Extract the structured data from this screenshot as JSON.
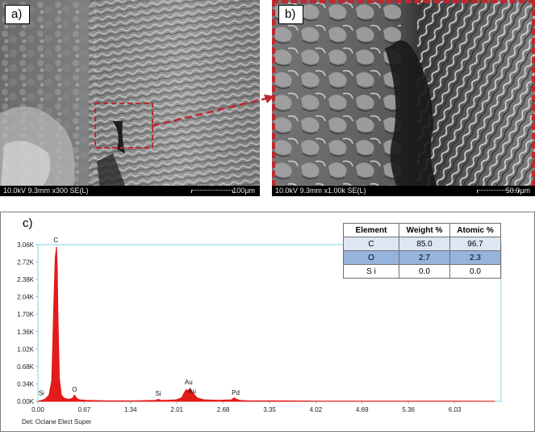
{
  "panel_a": {
    "label": "a)",
    "info": "10.0kV 9.3mm x300 SE(L)",
    "scale": "100µm"
  },
  "panel_b": {
    "label": "b)",
    "info": "10.0kV 9.3mm x1.00k SE(L)",
    "scale": "50.0µm"
  },
  "panel_c": {
    "label": "c)",
    "detector": "Det: Octane Elect Super",
    "table": {
      "headers": [
        "Element",
        "Weight %",
        "Atomic %"
      ],
      "rows": [
        {
          "element": "C",
          "weight": "85.0",
          "atomic": "96.7"
        },
        {
          "element": "O",
          "weight": "2.7",
          "atomic": "2.3"
        },
        {
          "element": "S i",
          "weight": "0.0",
          "atomic": "0.0"
        }
      ]
    }
  },
  "colors": {
    "highlight": "#c0272d",
    "spectrum": "#e31b1b",
    "axis": "#7fd0e6"
  },
  "chart_data": {
    "type": "area",
    "title": "",
    "xlabel": "",
    "ylabel": "",
    "xlim": [
      0.0,
      6.7
    ],
    "ylim": [
      0,
      3.06
    ],
    "x_ticks": [
      "0.00",
      "0.67",
      "1.34",
      "2.01",
      "2.68",
      "3.35",
      "4.02",
      "4.69",
      "5.36",
      "6.03"
    ],
    "y_ticks": [
      "0.00K",
      "0.34K",
      "0.68K",
      "1.02K",
      "1.36K",
      "1.70K",
      "2.04K",
      "2.38K",
      "2.72K",
      "3.06K"
    ],
    "series": [
      {
        "x": [
          0.0,
          0.1,
          0.16,
          0.2,
          0.23,
          0.25,
          0.27,
          0.28,
          0.29,
          0.31,
          0.34,
          0.38,
          0.45,
          0.5,
          0.53,
          0.56,
          0.6,
          0.7,
          1.0,
          1.4,
          1.7,
          1.74,
          1.78,
          1.85,
          2.0,
          2.08,
          2.12,
          2.15,
          2.17,
          2.2,
          2.24,
          2.3,
          2.4,
          2.6,
          2.8,
          2.84,
          2.87,
          2.92,
          3.05,
          3.4,
          4.0,
          5.0,
          6.0,
          6.6
        ],
        "values": [
          0.0,
          0.04,
          0.12,
          0.4,
          1.9,
          2.8,
          3.02,
          2.6,
          1.7,
          0.45,
          0.12,
          0.06,
          0.04,
          0.06,
          0.12,
          0.06,
          0.03,
          0.02,
          0.01,
          0.01,
          0.02,
          0.04,
          0.02,
          0.02,
          0.03,
          0.07,
          0.18,
          0.23,
          0.21,
          0.25,
          0.17,
          0.07,
          0.03,
          0.02,
          0.03,
          0.07,
          0.04,
          0.02,
          0.01,
          0.01,
          0.005,
          0.004,
          0.003,
          0.002
        ]
      }
    ],
    "annotations": [
      {
        "text": "Si",
        "x": 0.05,
        "y": 0.07
      },
      {
        "text": "C",
        "x": 0.26,
        "y": 3.06
      },
      {
        "text": "O",
        "x": 0.53,
        "y": 0.14
      },
      {
        "text": "Si",
        "x": 1.74,
        "y": 0.06
      },
      {
        "text": "Au",
        "x": 2.18,
        "y": 0.28
      },
      {
        "text": "Au",
        "x": 2.23,
        "y": 0.11
      },
      {
        "text": "Pd",
        "x": 2.86,
        "y": 0.08
      }
    ]
  }
}
